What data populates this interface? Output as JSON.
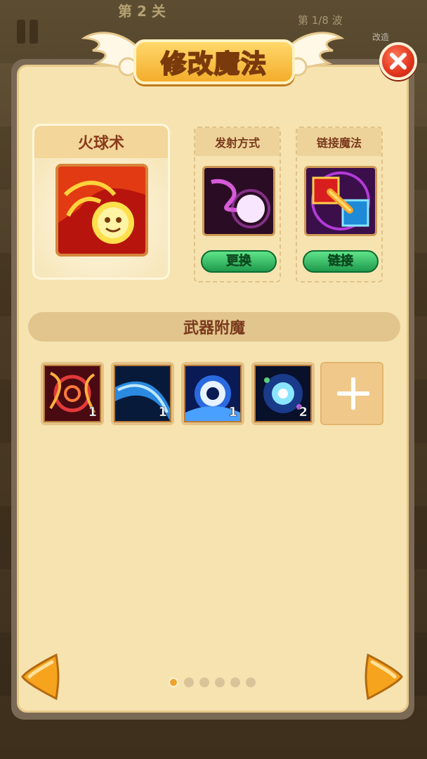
{
  "hud": {
    "level_label": "第 2 关",
    "wave_label": "第 1/8 波",
    "corner_tag": "改造"
  },
  "modal": {
    "title": "修改魔法"
  },
  "spell": {
    "name": "火球术"
  },
  "launch": {
    "header": "发射方式",
    "button": "更换"
  },
  "chain": {
    "header": "链接魔法",
    "button": "链接"
  },
  "enchant": {
    "header": "武器附魔",
    "slots": [
      {
        "count": "1",
        "icon": "fire-sigil-icon"
      },
      {
        "count": "1",
        "icon": "ice-slash-icon"
      },
      {
        "count": "1",
        "icon": "frost-vortex-icon"
      },
      {
        "count": "2",
        "icon": "arcane-burst-icon"
      }
    ]
  },
  "pagination": {
    "total_pages": 6,
    "current_page": 1
  },
  "colors": {
    "panel": "#f6e3b0",
    "accent_orange": "#f3ad2c",
    "button_green": "#1f9a4c",
    "close_red": "#e0341c"
  }
}
